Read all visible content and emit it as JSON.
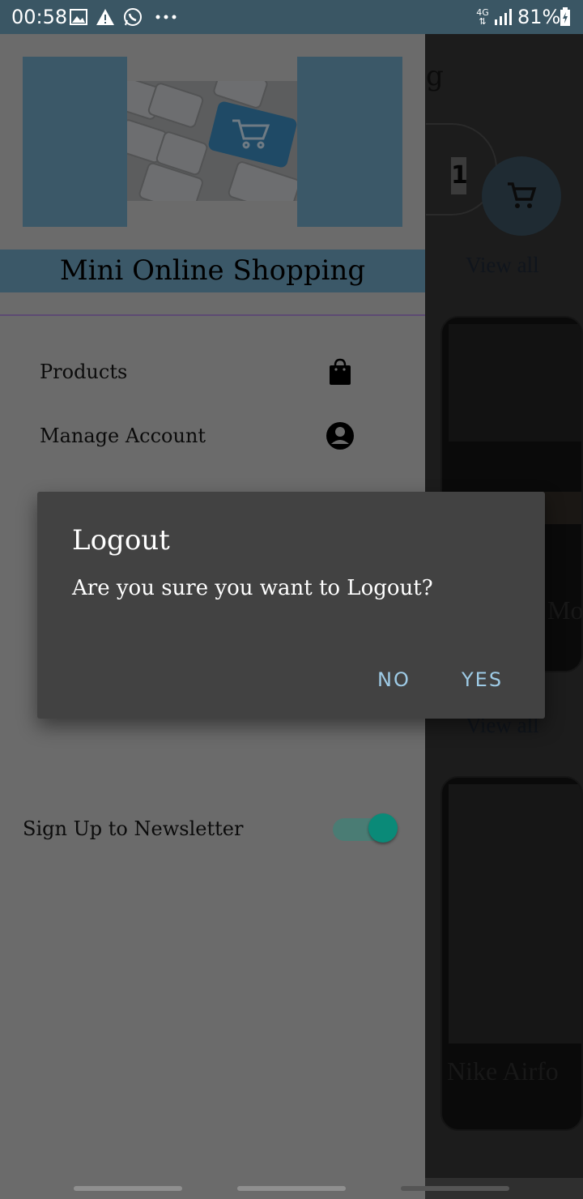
{
  "status_bar": {
    "time": "00:58",
    "network": "4G",
    "battery": "81%",
    "icons": [
      "image-icon",
      "warning-icon",
      "whatsapp-icon",
      "more-icon",
      "signal-icon",
      "battery-icon"
    ]
  },
  "background_screen": {
    "title_fragment": "g",
    "quantity": "1",
    "view_all_1": "View all",
    "view_all_2": "View all",
    "card_1_label": "Mo",
    "card_2_label": "Nike Airfo"
  },
  "drawer": {
    "header_image": "keyboard-cart-image",
    "app_title": "Mini Online Shopping",
    "menu_items": [
      {
        "label": "Products",
        "icon": "shopping-bag-icon"
      },
      {
        "label": "Manage Account",
        "icon": "account-circle-icon"
      }
    ],
    "newsletter": {
      "label": "Sign Up to Newsletter",
      "enabled": true
    }
  },
  "dialog": {
    "title": "Logout",
    "message": "Are you sure you want to Logout?",
    "no_label": "NO",
    "yes_label": "YES"
  },
  "colors": {
    "status_bar": "#3a5664",
    "brand": "#3b5868",
    "dialog_bg": "#424242",
    "dialog_button": "#9ecbe6",
    "switch_thumb": "#0a8a78"
  }
}
